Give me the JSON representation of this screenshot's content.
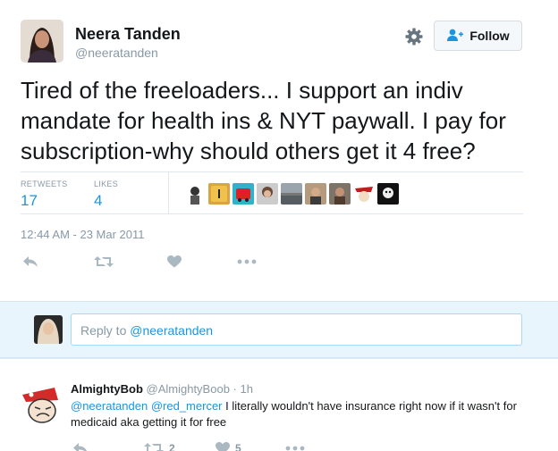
{
  "tweet": {
    "author_name": "Neera Tanden",
    "author_handle": "@neeratanden",
    "follow_label": "Follow",
    "text": "Tired of the freeloaders... I support an indiv mandate for health ins & NYT paywall. I pay for subscription-why should others get it 4 free?",
    "retweets_label": "RETWEETS",
    "retweets_count": "17",
    "likes_label": "LIKES",
    "likes_count": "4",
    "timestamp": "12:44 AM - 23 Mar 2011",
    "likers": [
      "liker-1",
      "liker-2",
      "liker-3",
      "liker-4",
      "liker-5",
      "liker-6",
      "liker-7",
      "liker-8",
      "liker-9"
    ]
  },
  "reply_box": {
    "prefix": "Reply to ",
    "mention": "@neeratanden"
  },
  "reply": {
    "name": "AlmightyBob",
    "handle": "@AlmightyBoob",
    "separator": "·",
    "time": "1h",
    "mention_1": "@neeratanden",
    "mention_2": "@red_mercer",
    "text": " I literally wouldn't have insurance right now if it wasn't for medicaid aka getting it for free",
    "retweet_count": "2",
    "like_count": "5"
  },
  "colors": {
    "accent": "#1b95e0",
    "muted": "#8899a6",
    "reply_bar_bg": "#e8f5fd"
  },
  "icons": [
    "gear-icon",
    "follow-person-plus-icon",
    "reply-icon",
    "retweet-icon",
    "heart-icon",
    "more-icon"
  ]
}
